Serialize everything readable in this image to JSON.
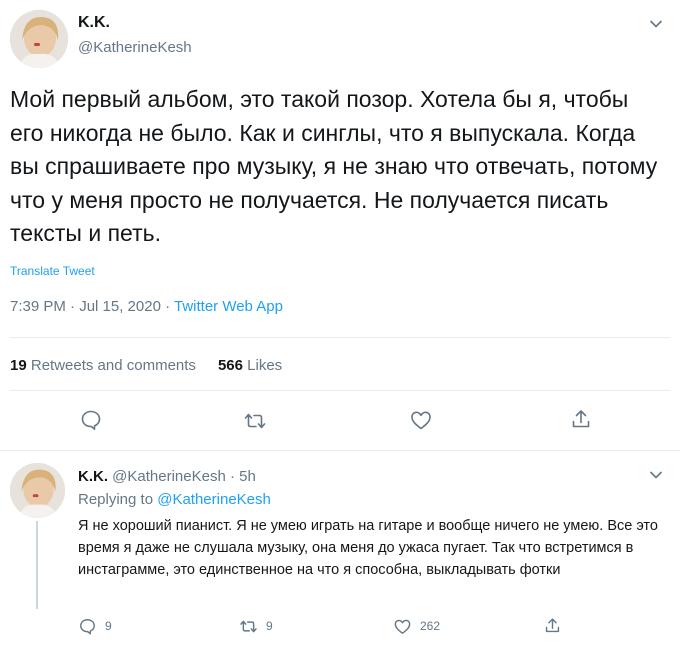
{
  "tweet": {
    "author_name": "K.K.",
    "author_handle": "@KatherineKesh",
    "text": "Мой первый альбом, это такой позор. Хотела бы я, чтобы его никогда не было. Как и синглы, что я выпускала. Когда вы спрашиваете про музыку, я не знаю что отвечать, потому что у меня просто не получается. Не получается писать тексты и петь.",
    "translate_label": "Translate Tweet",
    "time": "7:39 PM · Jul 15, 2020 · ",
    "source": "Twitter Web App",
    "retweets_count": "19",
    "retweets_label": "Retweets and comments",
    "likes_count": "566",
    "likes_label": "Likes"
  },
  "reply": {
    "author_name": "K.K.",
    "author_handle": "@KatherineKesh",
    "time": "· 5h",
    "replying_prefix": "Replying to ",
    "replying_to": "@KatherineKesh",
    "text": "Я не хороший пианист. Я не умею играть на гитаре и вообще ничего не умею. Все это время я даже не слушала музыку, она меня до ужаса пугает. Так что встретимся в инстаграмме, это единственное на что я способна, выкладывать фотки",
    "reply_count": "9",
    "retweet_count": "9",
    "like_count": "262"
  },
  "icons": {
    "reply": "comment-icon",
    "retweet": "retweet-icon",
    "like": "heart-icon",
    "share": "share-icon",
    "menu": "chevron-down-icon"
  },
  "colors": {
    "link": "#1da1f2",
    "secondary_text": "#657786",
    "divider": "#e6ecf0"
  }
}
